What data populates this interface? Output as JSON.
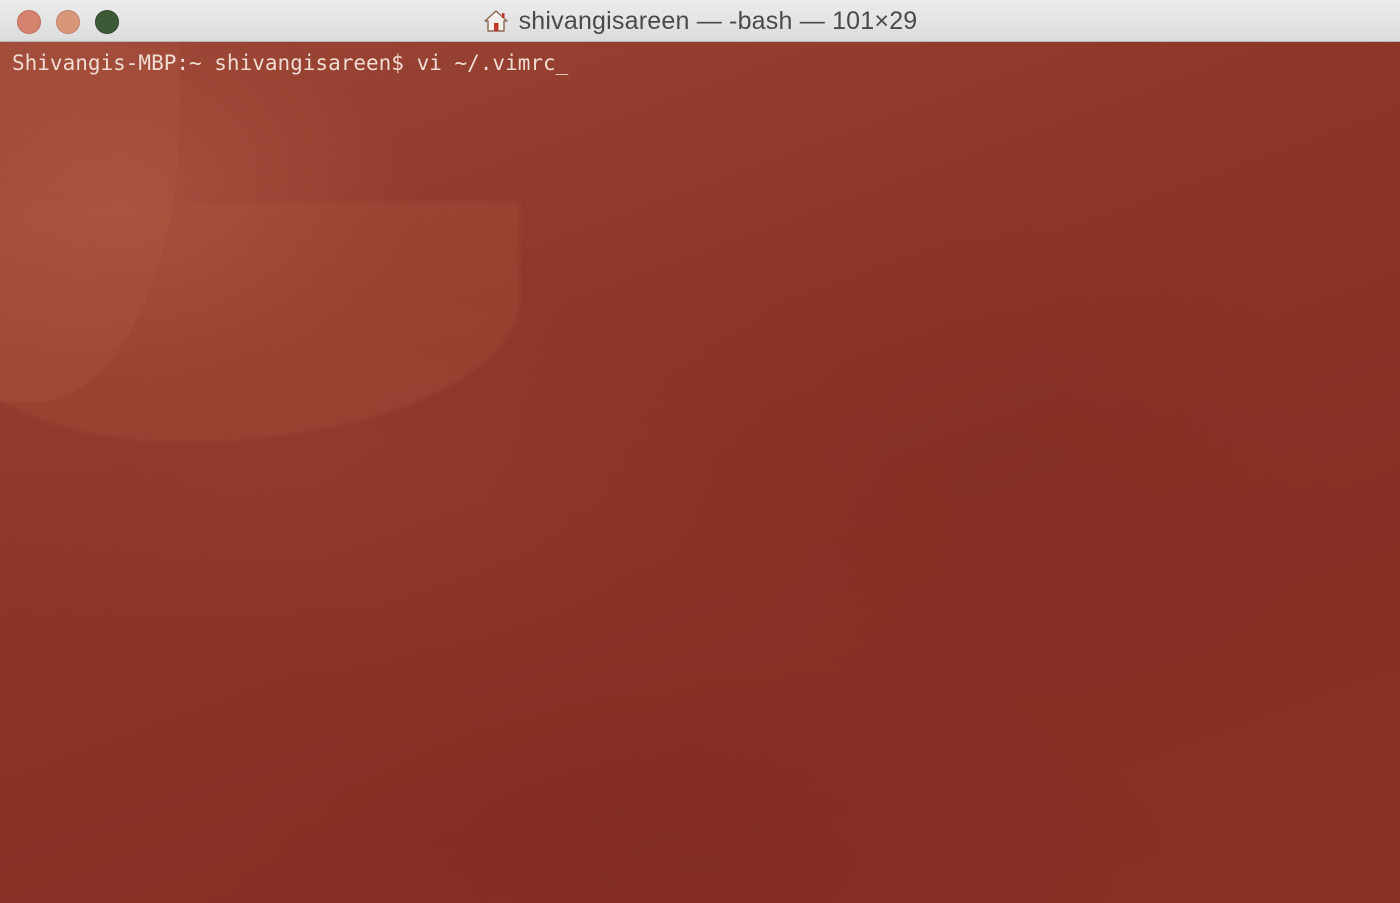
{
  "window": {
    "title": "shivangisareen — -bash — 101×29",
    "title_icon": "home-icon",
    "traffic_lights": {
      "close_color": "#d4846e",
      "minimize_color": "#d8967a",
      "zoom_color": "#3d5a37"
    }
  },
  "terminal": {
    "background_color": "#8a3428",
    "text_color": "#f0dcd2",
    "prompt": "Shivangis-MBP:~ shivangisareen$ ",
    "command": "vi ~/.vimrc",
    "cursor": "_"
  }
}
